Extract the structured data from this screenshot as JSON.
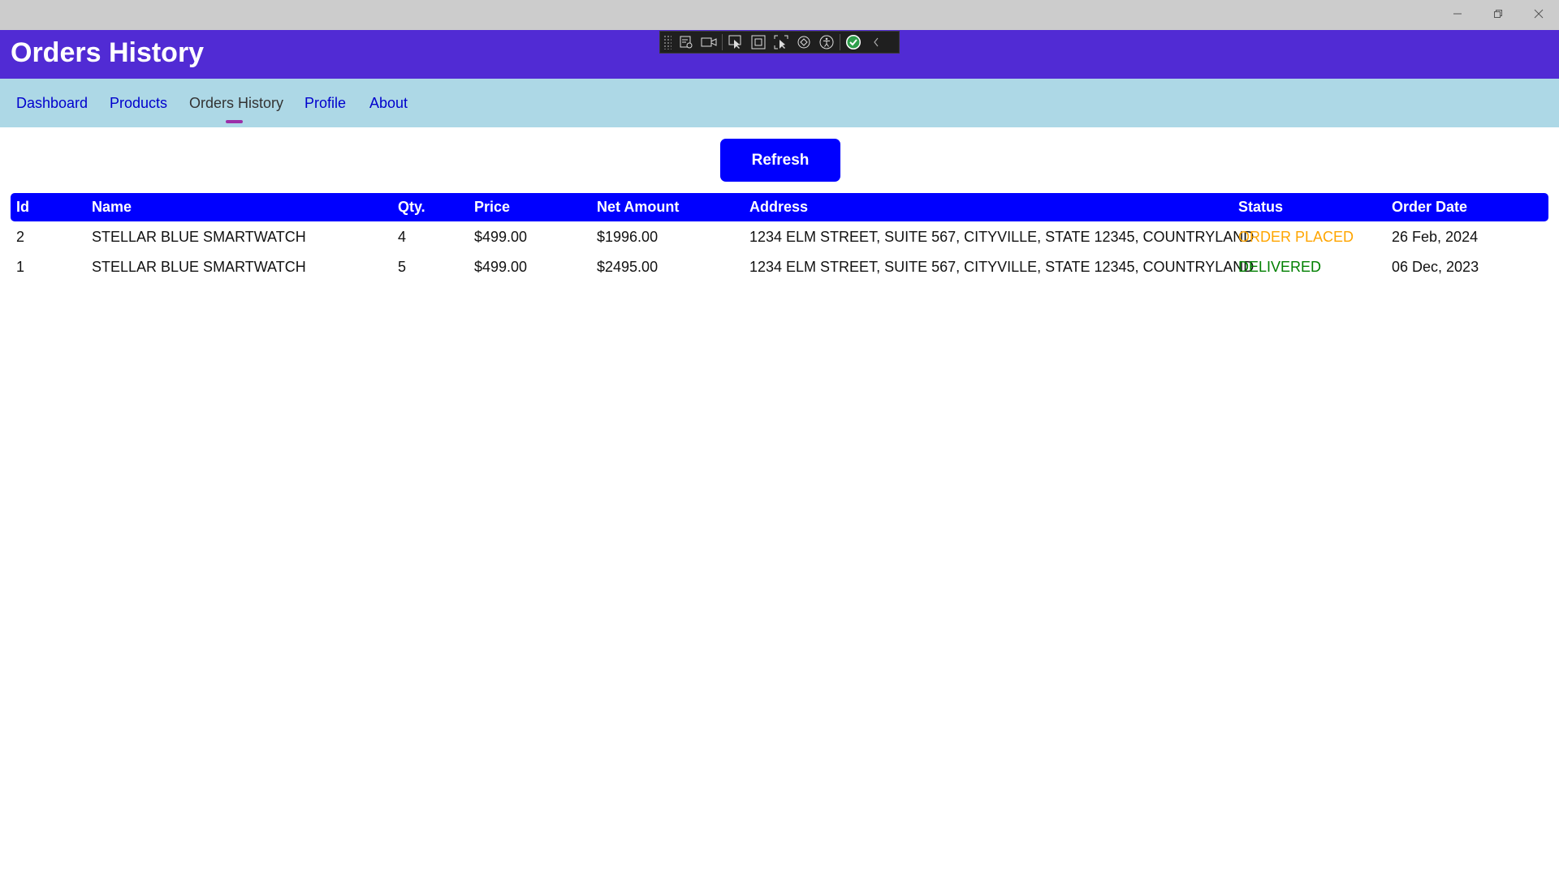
{
  "header": {
    "title": "Orders History"
  },
  "nav": {
    "items": [
      {
        "label": "Dashboard"
      },
      {
        "label": "Products"
      },
      {
        "label": "Orders History"
      },
      {
        "label": "Profile"
      },
      {
        "label": "About"
      }
    ],
    "active": "Orders History"
  },
  "refresh_label": "Refresh",
  "table": {
    "columns": [
      "Id",
      "Name",
      "Qty.",
      "Price",
      "Net Amount",
      "Address",
      "Status",
      "Order Date"
    ],
    "rows": [
      {
        "id": "2",
        "name": "STELLAR BLUE SMARTWATCH",
        "qty": "4",
        "price": "$499.00",
        "net_amount": "$1996.00",
        "address": "1234 ELM STREET, SUITE 567, CITYVILLE, STATE 12345, COUNTRYLAND",
        "status": "ORDER PLACED",
        "order_date": "26 Feb, 2024"
      },
      {
        "id": "1",
        "name": "STELLAR BLUE SMARTWATCH",
        "qty": "5",
        "price": "$499.00",
        "net_amount": "$2495.00",
        "address": "1234 ELM STREET, SUITE 567, CITYVILLE, STATE 12345, COUNTRYLAND",
        "status": "DELIVERED",
        "order_date": "06 Dec, 2023"
      }
    ]
  },
  "colors": {
    "header_bg": "#512bd4",
    "nav_bg": "#add8e6",
    "nav_link": "#0000cd",
    "primary": "#0000ff",
    "status_order_placed": "#ffa500",
    "status_delivered": "#008000"
  },
  "devtools": {
    "icons": [
      "live-visual-tree-icon",
      "record-icon",
      "select-element-icon",
      "display-layout-adorners-icon",
      "track-focus-icon",
      "hot-reload-icon",
      "accessibility-icon",
      "binding-check-icon",
      "collapse-chevron-icon"
    ]
  }
}
